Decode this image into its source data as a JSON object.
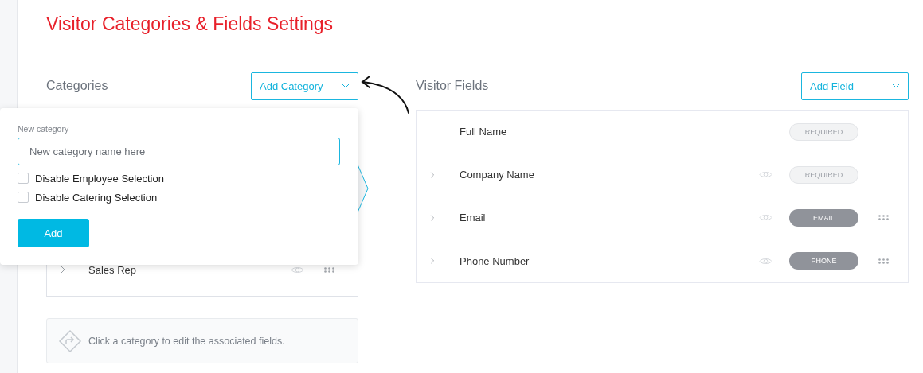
{
  "title": "Visitor Categories & Fields Settings",
  "categories": {
    "heading": "Categories",
    "add_button": "Add Category",
    "items": [
      {
        "name": "Sales Rep",
        "expanded": false
      }
    ],
    "hint": "Click a category to edit the associated fields."
  },
  "popover": {
    "label": "New category",
    "placeholder": "New category name here",
    "options": [
      {
        "label": "Disable Employee Selection",
        "checked": false
      },
      {
        "label": "Disable Catering Selection",
        "checked": false
      }
    ],
    "submit": "Add"
  },
  "fields": {
    "heading": "Visitor Fields",
    "add_button": "Add Field",
    "rows": [
      {
        "name": "Full Name",
        "expandable": false,
        "visibility": false,
        "badge": "REQUIRED",
        "kind": "required",
        "draggable": false
      },
      {
        "name": "Company Name",
        "expandable": true,
        "visibility": true,
        "badge": "REQUIRED",
        "kind": "required",
        "draggable": false
      },
      {
        "name": "Email",
        "expandable": true,
        "visibility": true,
        "badge": "EMAIL",
        "kind": "type",
        "draggable": true
      },
      {
        "name": "Phone Number",
        "expandable": true,
        "visibility": true,
        "badge": "PHONE",
        "kind": "type",
        "draggable": true
      }
    ]
  }
}
